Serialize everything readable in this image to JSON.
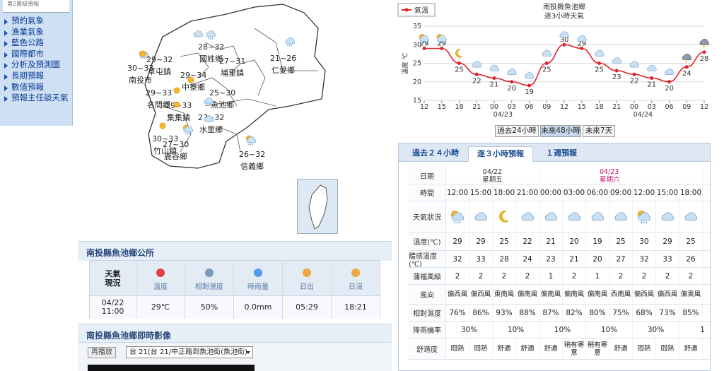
{
  "menu": {
    "top_text": "第2層級預報",
    "items": [
      "預約氣象",
      "漁業氣象",
      "藍色公路",
      "國際都市",
      "分析及預測圖",
      "長期預報",
      "數值預報",
      "預報主任談天氣"
    ]
  },
  "map": {
    "labels": [
      {
        "name": "南投市",
        "temp": "30~33",
        "icon": "sun-cloud"
      },
      {
        "name": "草屯鎮",
        "temp": "29~32",
        "icon": "sun"
      },
      {
        "name": "國姓鄉",
        "temp": "28~32",
        "icon": "rain"
      },
      {
        "name": "埔里鎮",
        "temp": "27~31",
        "icon": "cloud"
      },
      {
        "name": "仁愛鄉",
        "temp": "21~26",
        "icon": "rain"
      },
      {
        "name": "中寮鄉",
        "temp": "29~34",
        "icon": "sun"
      },
      {
        "name": "名間鄉",
        "temp": "29~33",
        "icon": "sun"
      },
      {
        "name": "集集鎮",
        "temp": "29~33",
        "icon": "sun"
      },
      {
        "name": "魚池鄉",
        "temp": "25~30",
        "icon": "cloud"
      },
      {
        "name": "水里鄉",
        "temp": "27~32",
        "icon": "cloud"
      },
      {
        "name": "竹山鎮",
        "temp": "30~33",
        "icon": "sun"
      },
      {
        "name": "鹿谷鄉",
        "temp": "27~30",
        "icon": "sun-rain"
      },
      {
        "name": "信義鄉",
        "temp": "26~32",
        "icon": "sun-rain"
      }
    ]
  },
  "station": {
    "title": "南投縣魚池鄉公所",
    "header_label": "天氣\n現況",
    "time": "04/22\n11:00",
    "columns": [
      {
        "label": "溫度",
        "icon": "thermometer-icon",
        "value": "29℃"
      },
      {
        "label": "相對溼度",
        "icon": "humidity-icon",
        "value": "50%"
      },
      {
        "label": "時雨量",
        "icon": "raindrop-icon",
        "value": "0.0mm"
      },
      {
        "label": "日出",
        "icon": "sunrise-icon",
        "value": "05:29"
      },
      {
        "label": "日沒",
        "icon": "sunset-icon",
        "value": "18:21"
      }
    ]
  },
  "camera": {
    "title": "南投縣魚池鄉即時影像",
    "replay": "再播放",
    "selected": "台 21(台 21/中正路到魚池街(魚池街)"
  },
  "chart_data": {
    "type": "line",
    "title": "南投縣魚池鄉",
    "subtitle": "逐3小時天氣",
    "legend": "氣溫",
    "ylabel": "溫度 ℃",
    "ylim": [
      15,
      35
    ],
    "yticks": [
      15,
      20,
      25,
      30,
      35
    ],
    "x": [
      "12",
      "15",
      "18",
      "21",
      "00",
      "03",
      "06",
      "09",
      "12",
      "15",
      "18",
      "21",
      "00",
      "03",
      "06",
      "09",
      "12"
    ],
    "date_labels": [
      "04/23",
      "04/24"
    ],
    "values": [
      29,
      29,
      25,
      22,
      21,
      20,
      19,
      25,
      30,
      29,
      25,
      23,
      22,
      21,
      20,
      24,
      28
    ],
    "icons": [
      "sun-rain",
      "sun-rain",
      "moon",
      "cloud",
      "cloud",
      "cloud",
      "cloud",
      "cloud",
      "cloud",
      "cloud",
      "cloud",
      "cloud",
      "cloud",
      "cloud",
      "cloud",
      "thunder",
      "thunder"
    ],
    "line_color": "#e1242b",
    "grid": true
  },
  "range_buttons": [
    "過去24小時",
    "未來48小時",
    "未來7天"
  ],
  "tabs": [
    "過去２４小時",
    "逐３小時預報",
    "１週預報"
  ],
  "forecast": {
    "date_label": "日期",
    "dates": [
      {
        "date": "04/22",
        "day": "星期五",
        "color": "#333"
      },
      {
        "date": "04/23",
        "day": "星期六",
        "color": "#c0186a"
      }
    ],
    "row_labels": [
      "時間",
      "天氣狀況",
      "溫度(℃)",
      "體感溫度(℃)",
      "蒲福風級",
      "風向",
      "相對濕度",
      "降雨機率",
      "舒適度"
    ],
    "times": [
      "12:00",
      "15:00",
      "18:00",
      "21:00",
      "00:00",
      "03:00",
      "06:00",
      "09:00",
      "12:00",
      "15:00",
      "18:00"
    ],
    "icons": [
      "sun-rain",
      "cloud",
      "moon",
      "cloud",
      "cloud",
      "cloud",
      "cloud",
      "cloud",
      "sun-rain",
      "cloud",
      "cloud"
    ],
    "temps": [
      "29",
      "29",
      "25",
      "22",
      "21",
      "20",
      "19",
      "25",
      "30",
      "29",
      "25"
    ],
    "feels": [
      "32",
      "33",
      "28",
      "24",
      "23",
      "21",
      "20",
      "27",
      "32",
      "33",
      "26"
    ],
    "wind": [
      "2",
      "2",
      "2",
      "2",
      "1",
      "2",
      "1",
      "2",
      "2",
      "2",
      "2"
    ],
    "wind_dir": [
      "偏西風",
      "偏西風",
      "東南風",
      "偏南風",
      "偏南風",
      "偏南風",
      "偏南風",
      "西南風",
      "偏西風",
      "偏西風",
      "偏東風"
    ],
    "humidity": [
      "76%",
      "86%",
      "93%",
      "88%",
      "87%",
      "82%",
      "80%",
      "75%",
      "68%",
      "73%",
      "85%"
    ],
    "rain_prob": [
      "30%",
      "10%",
      "10%",
      "10%",
      "30%",
      "1"
    ],
    "comfort": [
      "悶熱",
      "悶熱",
      "舒適",
      "舒適",
      "舒適",
      "稍有寒意",
      "稍有寒意",
      "舒適",
      "悶熱",
      "悶熱",
      "舒適"
    ]
  }
}
